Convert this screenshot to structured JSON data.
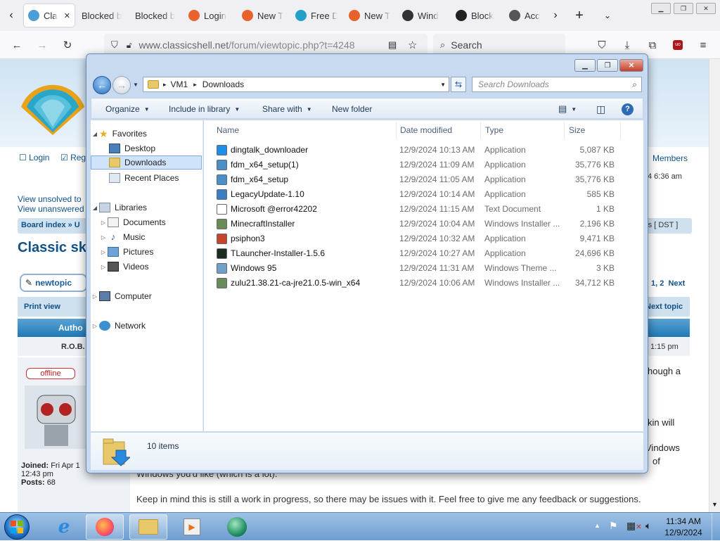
{
  "browser": {
    "tabs": [
      {
        "title": "Cla",
        "active": true,
        "fav": "#4a9fd8"
      },
      {
        "title": "Blocked b",
        "fav": ""
      },
      {
        "title": "Blocked b",
        "fav": ""
      },
      {
        "title": "Login",
        "fav": "#e8632b"
      },
      {
        "title": "New T",
        "fav": "#e8632b"
      },
      {
        "title": "Free D",
        "fav": "#22a0c8"
      },
      {
        "title": "New T",
        "fav": "#e8632b"
      },
      {
        "title": "Wind",
        "fav": "#333"
      },
      {
        "title": "Block",
        "fav": "#222"
      },
      {
        "title": "Acce",
        "fav": "#555"
      }
    ],
    "url_host": "www.classicshell.net",
    "url_path": "/forum/viewtopic.php?t=4248",
    "search_placeholder": "Search"
  },
  "webpage": {
    "login": "Login",
    "register": "Reg",
    "members": "Members",
    "date_right": "4 6:36 am",
    "unsolved": "View unsolved to",
    "unanswered": "View unanswered",
    "board_index": "Board index » U",
    "dst": "rs [ DST ]",
    "topic_title": "Classic sk",
    "new_topic": "newtopic",
    "pages": "1, 2",
    "next": "Next",
    "print_view": "Print view",
    "next_topic": "Next topic",
    "author": "Autho",
    "user": "R.O.B.",
    "time": "1:15 pm",
    "status": "offline",
    "joined_label": "Joined:",
    "joined_value": "Fri Apr 1",
    "joined_time": "12:43 pm",
    "posts_label": "Posts:",
    "posts_value": "68",
    "snippet_1": "hough a",
    "snippet_2": "kin will",
    "snippet_3": "Vindows",
    "snippet_4": "of",
    "snippet_5": "Windows you'd like (which is a lot).",
    "body_text": "Keep in mind this is still a work in progress, so there may be issues with it. Feel free to give me any feedback or suggestions."
  },
  "explorer": {
    "breadcrumb": [
      "VM1",
      "Downloads"
    ],
    "search_placeholder": "Search Downloads",
    "commands": {
      "organize": "Organize",
      "include": "Include in library",
      "share": "Share with",
      "new_folder": "New folder"
    },
    "nav": {
      "favorites": "Favorites",
      "desktop": "Desktop",
      "downloads": "Downloads",
      "recent": "Recent Places",
      "libraries": "Libraries",
      "documents": "Documents",
      "music": "Music",
      "pictures": "Pictures",
      "videos": "Videos",
      "computer": "Computer",
      "network": "Network"
    },
    "columns": {
      "name": "Name",
      "date": "Date modified",
      "type": "Type",
      "size": "Size"
    },
    "files": [
      {
        "name": "dingtalk_downloader",
        "date": "12/9/2024 10:13 AM",
        "type": "Application",
        "size": "5,087 KB",
        "icon": "#1f8ee8"
      },
      {
        "name": "fdm_x64_setup(1)",
        "date": "12/9/2024 11:09 AM",
        "type": "Application",
        "size": "35,776 KB",
        "icon": "#4a8fc6"
      },
      {
        "name": "fdm_x64_setup",
        "date": "12/9/2024 11:05 AM",
        "type": "Application",
        "size": "35,776 KB",
        "icon": "#4a8fc6"
      },
      {
        "name": "LegacyUpdate-1.10",
        "date": "12/9/2024 10:14 AM",
        "type": "Application",
        "size": "585 KB",
        "icon": "#3c7fc0"
      },
      {
        "name": "Microsoft @error42202",
        "date": "12/9/2024 11:15 AM",
        "type": "Text Document",
        "size": "1 KB",
        "icon": "#ffffff"
      },
      {
        "name": "MinecraftInstaller",
        "date": "12/9/2024 10:04 AM",
        "type": "Windows Installer ...",
        "size": "2,196 KB",
        "icon": "#6a8a5a"
      },
      {
        "name": "psiphon3",
        "date": "12/9/2024 10:32 AM",
        "type": "Application",
        "size": "9,471 KB",
        "icon": "#c4452c"
      },
      {
        "name": "TLauncher-Installer-1.5.6",
        "date": "12/9/2024 10:27 AM",
        "type": "Application",
        "size": "24,696 KB",
        "icon": "#1b2b1f"
      },
      {
        "name": "Windows 95",
        "date": "12/9/2024 11:31 AM",
        "type": "Windows Theme ...",
        "size": "3 KB",
        "icon": "#6fa0c8"
      },
      {
        "name": "zulu21.38.21-ca-jre21.0.5-win_x64",
        "date": "12/9/2024 10:06 AM",
        "type": "Windows Installer ...",
        "size": "34,712 KB",
        "icon": "#6a8a5a"
      }
    ],
    "item_count": "10 items"
  },
  "taskbar": {
    "time": "11:34 AM",
    "date": "12/9/2024"
  }
}
